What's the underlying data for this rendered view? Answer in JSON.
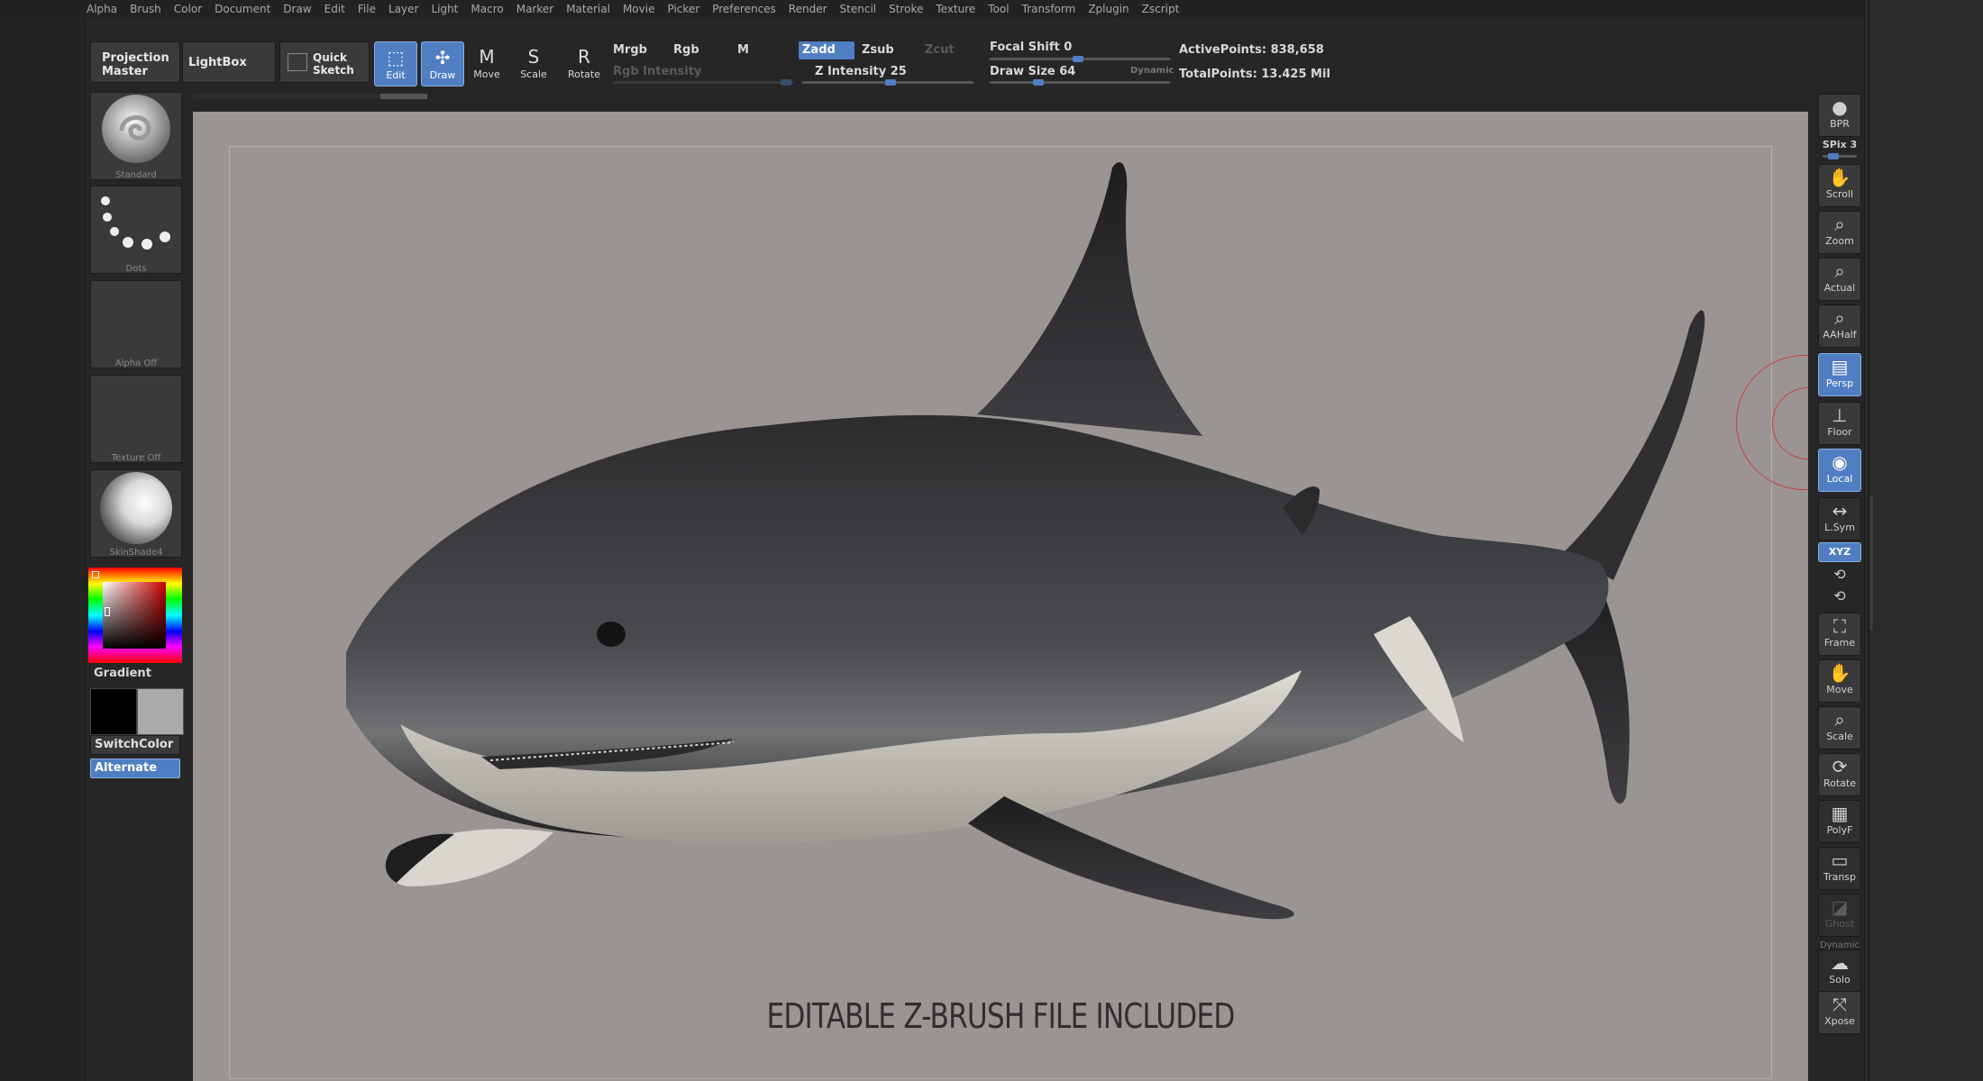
{
  "menu": [
    "Alpha",
    "Brush",
    "Color",
    "Document",
    "Draw",
    "Edit",
    "File",
    "Layer",
    "Light",
    "Macro",
    "Marker",
    "Material",
    "Movie",
    "Picker",
    "Preferences",
    "Render",
    "Stencil",
    "Stroke",
    "Texture",
    "Tool",
    "Transform",
    "Zplugin",
    "Zscript"
  ],
  "toolbar": {
    "projection_master": "Projection Master",
    "lightbox": "LightBox",
    "quick_sketch": "Quick Sketch",
    "edit": "Edit",
    "draw": "Draw",
    "move": "Move",
    "scale": "Scale",
    "rotate": "Rotate",
    "mrgb": "Mrgb",
    "rgb": "Rgb",
    "m": "M",
    "zadd": "Zadd",
    "zsub": "Zsub",
    "zcut": "Zcut",
    "rgb_intensity": "Rgb Intensity",
    "z_intensity": "Z Intensity 25",
    "focal_shift": "Focal Shift 0",
    "draw_size": "Draw Size 64",
    "dynamic": "Dynamic",
    "active_points": "ActivePoints: 838,658",
    "total_points": "TotalPoints: 13.425 Mil"
  },
  "left": {
    "brush": "Standard",
    "stroke": "Dots",
    "alpha": "Alpha Off",
    "texture": "Texture Off",
    "material": "SkinShade4",
    "gradient": "Gradient",
    "switch_color": "SwitchColor",
    "alternate": "Alternate"
  },
  "right": {
    "bpr": "BPR",
    "spix": "SPix 3",
    "scroll": "Scroll",
    "zoom": "Zoom",
    "actual": "Actual",
    "aahalf": "AAHalf",
    "persp": "Persp",
    "floor": "Floor",
    "local": "Local",
    "lsym": "L.Sym",
    "xyz": "XYZ",
    "frame": "Frame",
    "move": "Move",
    "scale": "Scale",
    "rotate": "Rotate",
    "polyf": "PolyF",
    "transp": "Transp",
    "ghost": "Ghost",
    "dynamic": "Dynamic",
    "solo": "Solo",
    "xpose": "Xpose"
  },
  "viewport": {
    "caption": "EDITABLE Z-BRUSH FILE INCLUDED"
  },
  "colors": {
    "accent": "#4f7ec2",
    "canvas": "#9a9593",
    "panel": "#262626"
  }
}
